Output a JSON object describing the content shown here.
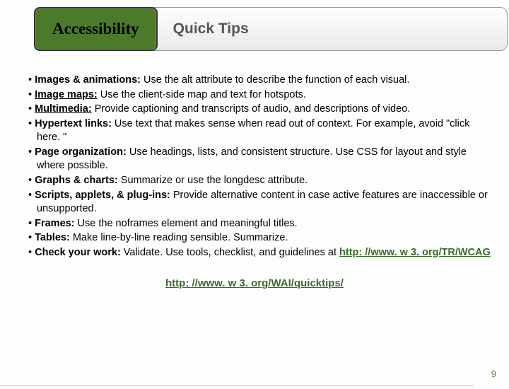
{
  "header": {
    "tab": "Accessibility",
    "title": "Quick Tips"
  },
  "tips": [
    {
      "label": "Images & animations:",
      "text": " Use the alt attribute to describe the function of each visual.",
      "underline_label": false
    },
    {
      "label": "Image maps:",
      "text": " Use the client-side map and text for hotspots.",
      "underline_label": true
    },
    {
      "label": "Multimedia:",
      "text": " Provide captioning and transcripts of audio, and descriptions of video.",
      "underline_label": true
    },
    {
      "label": "Hypertext links:",
      "text": " Use text that makes sense when read out of context. For example, avoid \"click here. \"",
      "underline_label": false
    },
    {
      "label": "Page organization:",
      "text": " Use headings, lists, and consistent structure. Use CSS for layout and style where possible.",
      "underline_label": false
    },
    {
      "label": "Graphs & charts:",
      "text": " Summarize or use the longdesc attribute.",
      "underline_label": false
    },
    {
      "label": "Scripts, applets, & plug-ins:",
      "text": " Provide alternative content in case active features are inaccessible or unsupported.",
      "underline_label": false
    },
    {
      "label": "Frames:",
      "text": " Use the noframes element and meaningful titles.",
      "underline_label": false
    },
    {
      "label": "Tables:",
      "text": " Make line-by-line reading sensible. Summarize.",
      "underline_label": false
    },
    {
      "label": "Check your work:",
      "text": " Validate. Use tools, checklist, and guidelines at ",
      "underline_label": false,
      "trailing_link": "http: //www. w 3. org/TR/WCAG"
    }
  ],
  "footer_link": "http: //www. w 3. org/WAI/quicktips/",
  "page_number": "9"
}
